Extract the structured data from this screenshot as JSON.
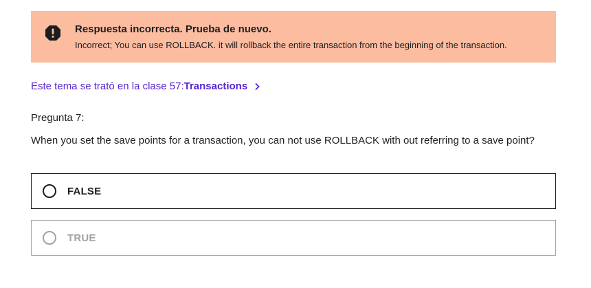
{
  "alert": {
    "icon": "exclamation-icon",
    "title": "Respuesta incorrecta. Prueba de nuevo.",
    "message": "Incorrect; You can use ROLLBACK. it will rollback the entire transaction from the beginning of the transaction.",
    "background_color": "#fcbca0"
  },
  "lecture_link": {
    "prefix": "Este tema se trató en la clase 57:",
    "lecture_name": "Transactions",
    "icon": "chevron-right-icon",
    "color": "#5624d0"
  },
  "question": {
    "number_label": "Pregunta 7:",
    "text": "When you set the save points for a transaction, you can not use ROLLBACK with out referring to a save point?"
  },
  "options": [
    {
      "label": "FALSE",
      "state": "selected"
    },
    {
      "label": "TRUE",
      "state": "disabled"
    }
  ]
}
